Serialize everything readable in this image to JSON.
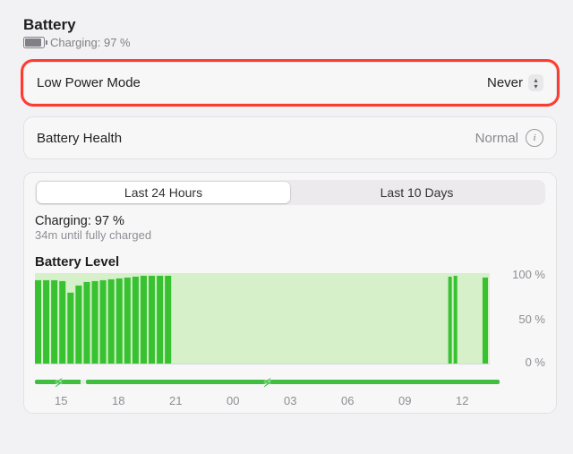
{
  "header": {
    "title": "Battery",
    "status_text": "Charging: 97 %"
  },
  "low_power": {
    "label": "Low Power Mode",
    "value": "Never"
  },
  "health": {
    "label": "Battery Health",
    "value": "Normal"
  },
  "range_tabs": {
    "last24": "Last 24 Hours",
    "last10d": "Last 10 Days",
    "selected": "last24"
  },
  "summary": {
    "line1": "Charging: 97 %",
    "line2": "34m until fully charged"
  },
  "chart_data": {
    "type": "bar",
    "title": "Battery Level",
    "ylabel": "",
    "ylim": [
      0,
      100
    ],
    "yticks": [
      "0 %",
      "50 %",
      "100 %"
    ],
    "categories": [
      "15",
      "18",
      "21",
      "00",
      "03",
      "06",
      "09",
      "12"
    ],
    "values_by_hour": [
      {
        "h": 14,
        "v": 92
      },
      {
        "h": 14.33,
        "v": 92
      },
      {
        "h": 14.66,
        "v": 92
      },
      {
        "h": 15,
        "v": 91
      },
      {
        "h": 15.33,
        "v": 78
      },
      {
        "h": 15.66,
        "v": 86
      },
      {
        "h": 16,
        "v": 90
      },
      {
        "h": 16.33,
        "v": 91
      },
      {
        "h": 16.66,
        "v": 92
      },
      {
        "h": 17,
        "v": 93
      },
      {
        "h": 17.33,
        "v": 94
      },
      {
        "h": 17.66,
        "v": 95
      },
      {
        "h": 18,
        "v": 96
      },
      {
        "h": 18.33,
        "v": 97
      },
      {
        "h": 18.66,
        "v": 97
      },
      {
        "h": 19,
        "v": 97
      },
      {
        "h": 19.33,
        "v": 97
      },
      {
        "h": 19.66,
        "v": 97
      },
      {
        "h": 12,
        "v": 96
      },
      {
        "h": 12.33,
        "v": 97
      },
      {
        "h": 13,
        "v": 95
      }
    ],
    "charging_intervals": [
      {
        "from": 14,
        "to": 16.5
      },
      {
        "from": 16.5,
        "to": 12.5
      }
    ]
  }
}
